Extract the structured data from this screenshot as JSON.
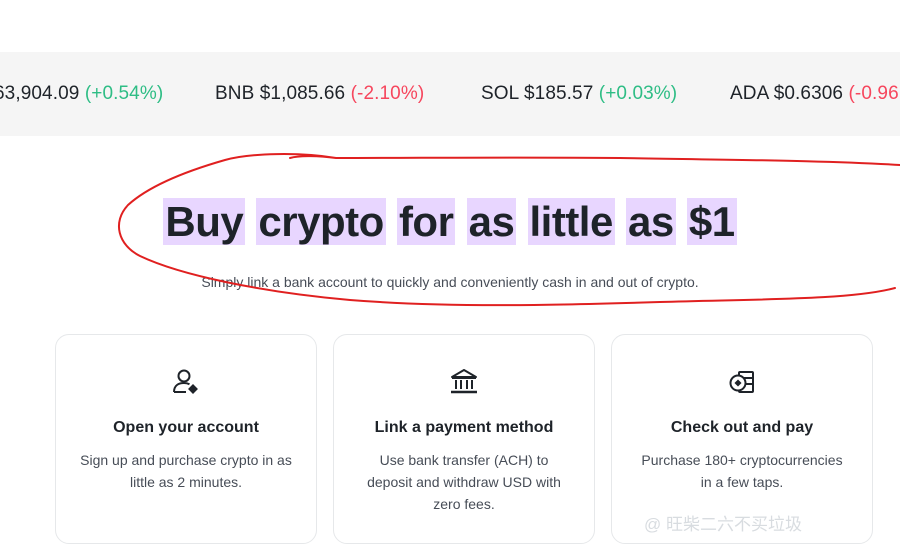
{
  "ticker": {
    "items": [
      {
        "symbol": "",
        "price": "63,904.09",
        "change": "(+0.54%)",
        "direction": "up"
      },
      {
        "symbol": "BNB",
        "price": "$1,085.66",
        "change": "(-2.10%)",
        "direction": "down"
      },
      {
        "symbol": "SOL",
        "price": "$185.57",
        "change": "(+0.03%)",
        "direction": "up"
      },
      {
        "symbol": "ADA",
        "price": "$0.6306",
        "change": "(-0.96",
        "direction": "down"
      }
    ]
  },
  "hero": {
    "title_words": [
      "Buy",
      "crypto",
      "for",
      "as",
      "little",
      "as",
      "$1"
    ],
    "subtitle": "Simply link a bank account to quickly and conveniently cash in and out of crypto."
  },
  "cards": [
    {
      "title": "Open your account",
      "description": "Sign up and purchase crypto in as little as 2 minutes.",
      "icon": "user-account-icon"
    },
    {
      "title": "Link a payment method",
      "description": "Use bank transfer (ACH) to deposit and withdraw USD with zero fees.",
      "icon": "bank-icon"
    },
    {
      "title": "Check out and pay",
      "description": "Purchase 180+ cryptocurrencies in a few taps.",
      "icon": "coins-icon"
    }
  ],
  "watermark": "@ 旺柴二六不买垃圾",
  "colors": {
    "up": "#2ebd85",
    "down": "#f6465d",
    "highlight": "#e8d6ff",
    "annotation": "#e02020"
  }
}
